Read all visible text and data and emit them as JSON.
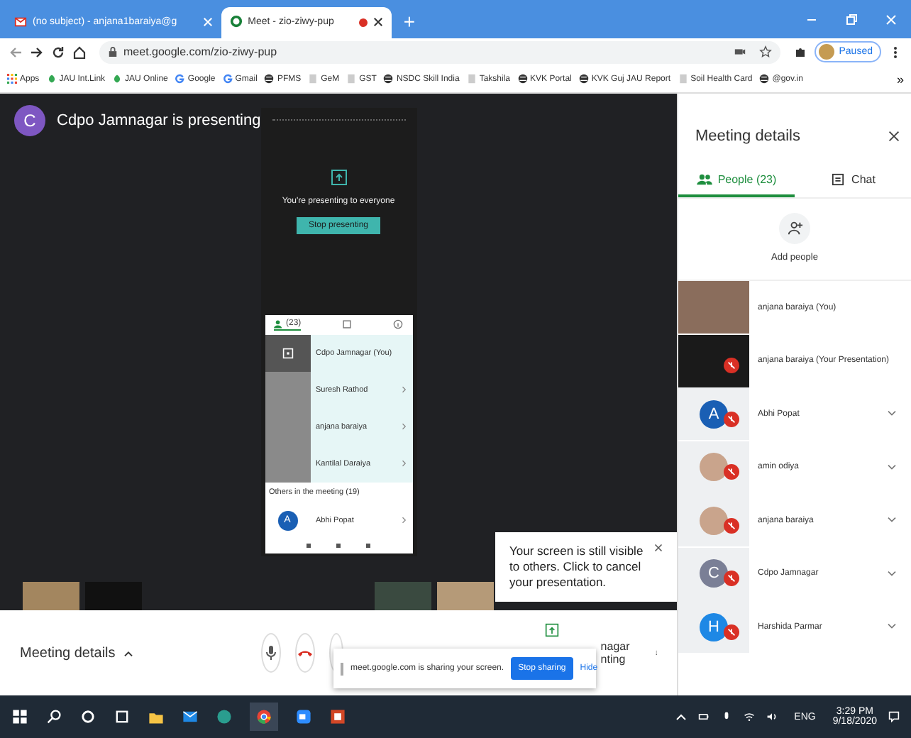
{
  "browser": {
    "tabs": [
      {
        "title": "(no subject) - anjana1baraiya@g",
        "kind": "mail",
        "selected": false,
        "recording": false
      },
      {
        "title": "Meet - zio-ziwy-pup",
        "kind": "meet",
        "selected": true,
        "recording": true
      }
    ],
    "new_tab": "+",
    "address": "meet.google.com/zio-ziwy-pup",
    "profile": "Paused",
    "bookmarks": [
      {
        "label": "Apps",
        "kind": "grid"
      },
      {
        "label": "JAU Int.Link",
        "kind": "leaf"
      },
      {
        "label": "JAU Online",
        "kind": "leaf"
      },
      {
        "label": "Google",
        "kind": "g"
      },
      {
        "label": "Gmail",
        "kind": "g"
      },
      {
        "label": "PFMS",
        "kind": "globe"
      },
      {
        "label": "GeM",
        "kind": "other"
      },
      {
        "label": "GST",
        "kind": "other"
      },
      {
        "label": "NSDC Skill India",
        "kind": "globe"
      },
      {
        "label": "Takshila",
        "kind": "other"
      },
      {
        "label": "KVK Portal",
        "kind": "globe"
      },
      {
        "label": "KVK Guj JAU Report",
        "kind": "globe"
      },
      {
        "label": "Soil Health Card",
        "kind": "other"
      },
      {
        "label": "@gov.in",
        "kind": "globe"
      }
    ],
    "more": "»"
  },
  "stage": {
    "presenter_initial": "C",
    "presenter_title": "Cdpo Jamnagar is presenting",
    "phone": {
      "presenting_text": "You're presenting to everyone",
      "stop_button": "Stop presenting",
      "people_count": "(23)",
      "participants": [
        {
          "name": "Cdpo Jamnagar (You)",
          "kind": "screen"
        },
        {
          "name": "Suresh Rathod",
          "kind": "video"
        },
        {
          "name": "anjana baraiya",
          "kind": "video"
        },
        {
          "name": "Kantilal Daraiya",
          "kind": "video"
        }
      ],
      "others_heading": "Others in the meeting (19)",
      "others": [
        {
          "initial": "A",
          "name": "Abhi Popat"
        }
      ]
    },
    "tooltip": "Your screen is still visible to others. Click to cancel your presentation."
  },
  "bottom_bar": {
    "meeting_details": "Meeting details",
    "presenter_line_1": "nagar",
    "presenter_line_2": "nting"
  },
  "share_bar": {
    "text": "meet.google.com is sharing your screen.",
    "stop_button": "Stop sharing",
    "hide_link": "Hide"
  },
  "panel": {
    "title": "Meeting details",
    "tabs": [
      {
        "label": "People (23)",
        "kind": "people",
        "selected": true
      },
      {
        "label": "Chat",
        "kind": "chat",
        "selected": false
      }
    ],
    "add_people": "Add people",
    "people": [
      {
        "name": "anjana baraiya (You)",
        "kind": "video",
        "muted": false
      },
      {
        "name": "anjana baraiya (Your Presentation)",
        "kind": "presentation",
        "muted": true
      },
      {
        "name": "Abhi Popat",
        "kind": "initial",
        "initial": "A",
        "color": "#1a5fb4",
        "muted": true
      },
      {
        "name": "amin odiya",
        "kind": "photo",
        "muted": true
      },
      {
        "name": "anjana baraiya",
        "kind": "photo",
        "muted": true
      },
      {
        "name": "Cdpo Jamnagar",
        "kind": "initial",
        "initial": "C",
        "color": "#7a7f96",
        "muted": true
      },
      {
        "name": "Harshida Parmar",
        "kind": "initial",
        "initial": "H",
        "color": "#1e88e5",
        "muted": true
      }
    ]
  },
  "taskbar": {
    "language": "ENG",
    "time": "3:29 PM",
    "date": "9/18/2020"
  }
}
